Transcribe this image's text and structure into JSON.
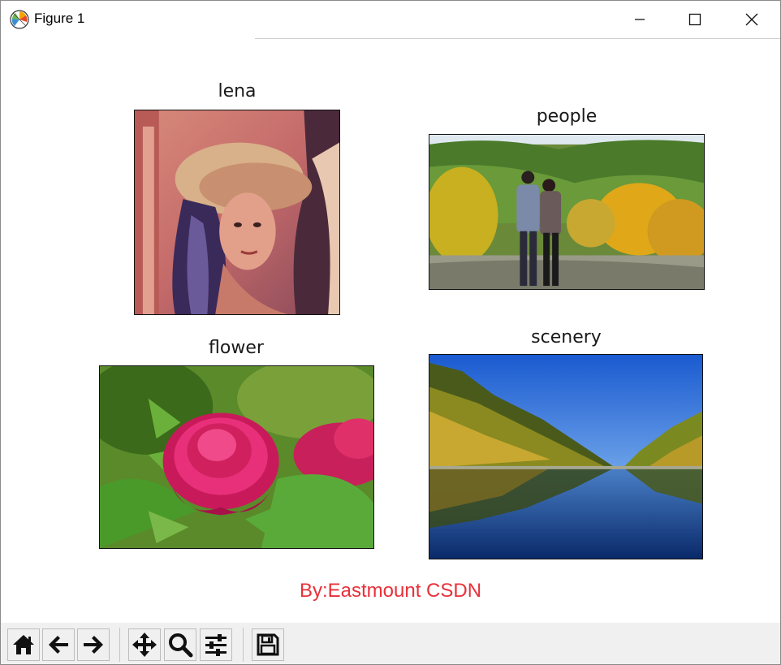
{
  "window": {
    "title": "Figure 1",
    "controls": {
      "minimize": "minimize-icon",
      "maximize": "maximize-icon",
      "close": "close-icon"
    }
  },
  "figure": {
    "subplots": [
      {
        "title": "lena",
        "image": "portrait photo of woman in hat"
      },
      {
        "title": "people",
        "image": "two people standing in autumn mountain landscape"
      },
      {
        "title": "flower",
        "image": "pink peony flower with green leaves"
      },
      {
        "title": "scenery",
        "image": "forest river reflection under blue sky"
      }
    ],
    "credit": "By:Eastmount CSDN",
    "credit_color": "#e8303a"
  },
  "toolbar": {
    "buttons": [
      {
        "name": "home",
        "icon": "home-icon"
      },
      {
        "name": "back",
        "icon": "back-arrow-icon"
      },
      {
        "name": "forward",
        "icon": "forward-arrow-icon"
      },
      {
        "name": "pan",
        "icon": "pan-move-icon"
      },
      {
        "name": "zoom",
        "icon": "zoom-magnifier-icon"
      },
      {
        "name": "configure-subplots",
        "icon": "sliders-icon"
      },
      {
        "name": "save",
        "icon": "save-disk-icon"
      }
    ]
  }
}
